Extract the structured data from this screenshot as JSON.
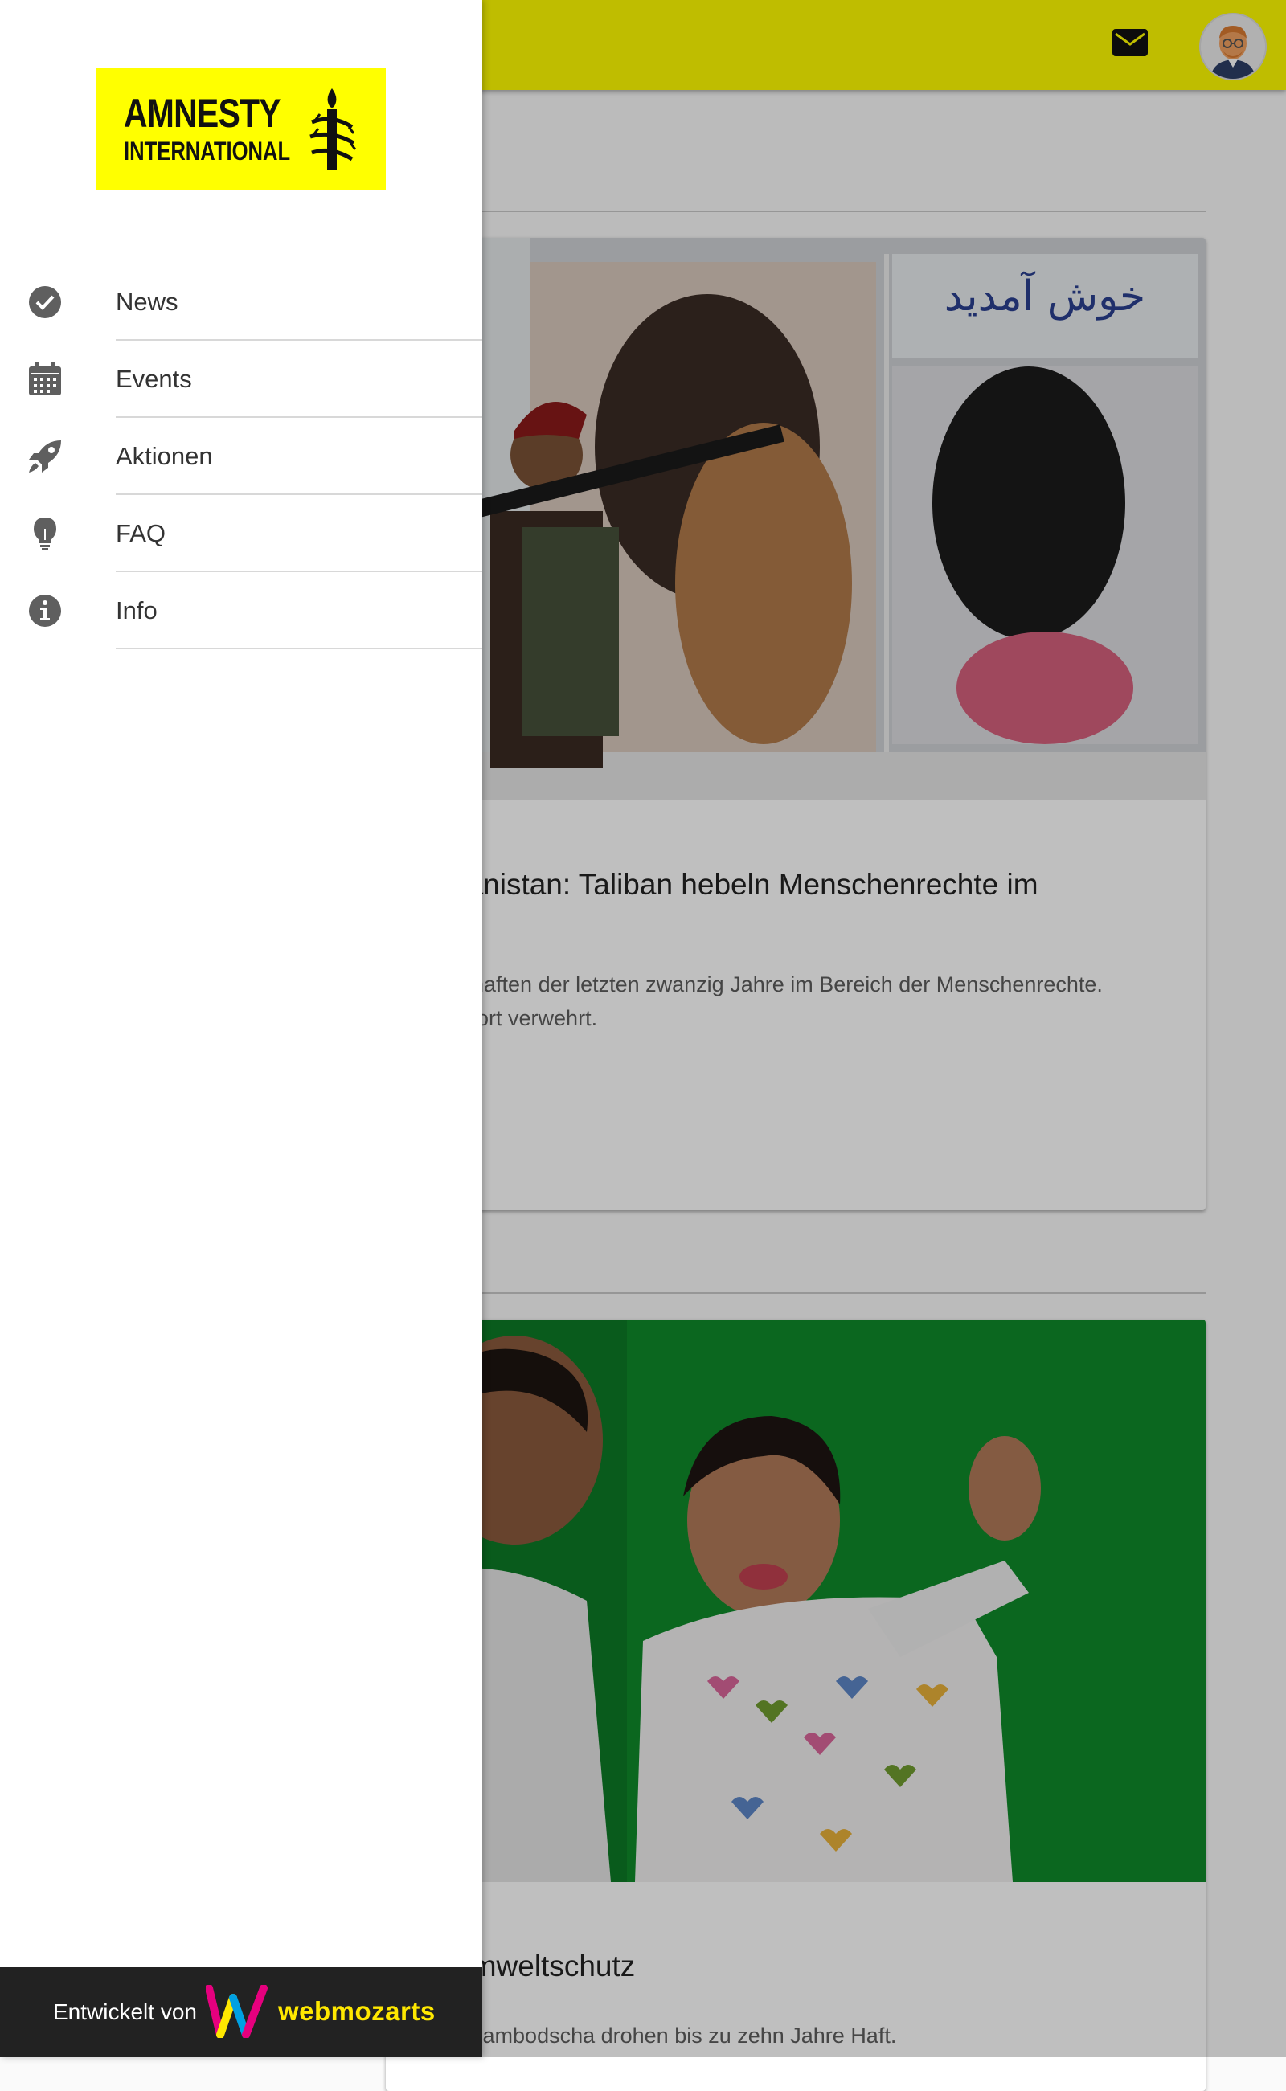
{
  "colors": {
    "accent": "#fffd00",
    "drawer_footer": "#222222",
    "brand_text": "#ffe800"
  },
  "header": {
    "mail_icon": "mail-icon",
    "avatar": "user-avatar"
  },
  "drawer": {
    "logo": {
      "line1": "AMNESTY",
      "line2": "INTERNATIONAL"
    },
    "items": [
      {
        "label": "News",
        "icon": "check-circle-icon"
      },
      {
        "label": "Events",
        "icon": "calendar-icon"
      },
      {
        "label": "Aktionen",
        "icon": "rocket-icon"
      },
      {
        "label": "FAQ",
        "icon": "lightbulb-icon"
      },
      {
        "label": "Info",
        "icon": "info-icon"
      }
    ],
    "footer": {
      "developed_by": "Entwickelt von",
      "brand": "webmozarts"
    }
  },
  "articles": [
    {
      "title": "hanistan: Taliban hebeln Menschenrechte im",
      "text_line1": "schaften der letzten zwanzig Jahre im Bereich der Menschenrechte.",
      "text_line2": "Sport verwehrt."
    },
    {
      "title": "Umweltschutz",
      "text_line1": "n Kambodscha drohen bis zu zehn Jahre Haft."
    }
  ]
}
